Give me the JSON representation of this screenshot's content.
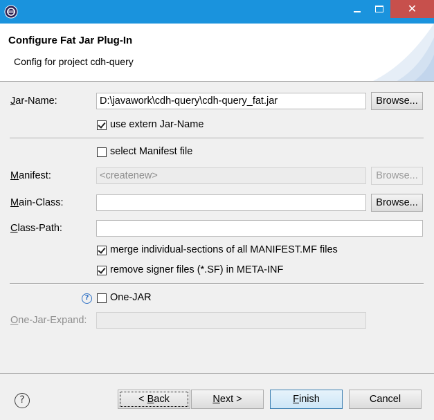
{
  "window": {
    "app_icon": "eclipse-icon",
    "minimize_icon": "minimize-icon",
    "maximize_icon": "maximize-icon",
    "close_icon": "close-icon",
    "close_glyph": "✕"
  },
  "header": {
    "title": "Configure Fat Jar Plug-In",
    "subtitle": "Config for project cdh-query"
  },
  "form": {
    "jar_name": {
      "mnemonic": "J",
      "label_rest": "ar-Name:",
      "value": "D:\\javawork\\cdh-query\\cdh-query_fat.jar",
      "browse": "Browse..."
    },
    "use_extern": {
      "label": "use extern Jar-Name",
      "checked": true
    },
    "select_manifest": {
      "label": "select Manifest file",
      "checked": false
    },
    "manifest": {
      "mnemonic": "M",
      "label_rest": "anifest:",
      "value": "<createnew>",
      "browse": "Browse..."
    },
    "main_class": {
      "mnemonic": "M",
      "label_rest": "ain-Class:",
      "value": "",
      "browse": "Browse..."
    },
    "class_path": {
      "mnemonic": "C",
      "label_rest": "lass-Path:",
      "value": ""
    },
    "merge_sections": {
      "label": "merge individual-sections of all MANIFEST.MF files",
      "checked": true
    },
    "remove_signer": {
      "label": "remove signer files (*.SF) in META-INF",
      "checked": true
    },
    "one_jar": {
      "label": "One-JAR",
      "checked": false,
      "help_icon": "help-icon",
      "help_glyph": "?"
    },
    "one_jar_expand": {
      "mnemonic": "O",
      "label_rest": "ne-Jar-Expand:",
      "value": ""
    }
  },
  "footer": {
    "help_icon": "help-icon",
    "help_glyph": "?",
    "back": {
      "prefix": "< ",
      "mnemonic": "B",
      "rest": "ack"
    },
    "next": {
      "mnemonic": "N",
      "rest": "ext >"
    },
    "finish": {
      "mnemonic": "F",
      "rest": "inish"
    },
    "cancel": "Cancel"
  },
  "colors": {
    "titlebar": "#1a93dd",
    "close_button": "#c7504c",
    "dialog_bg": "#f0f0f0",
    "focus_button_border": "#3c7fb1"
  }
}
